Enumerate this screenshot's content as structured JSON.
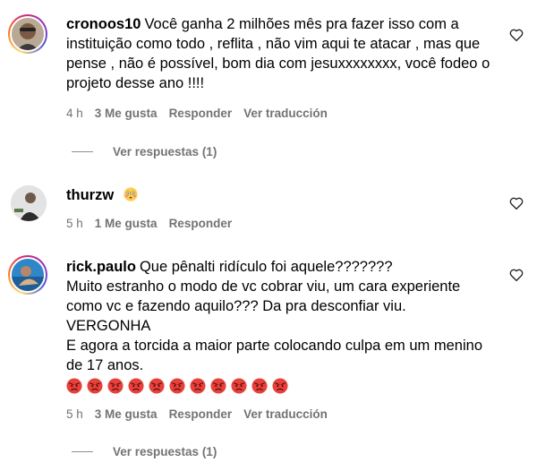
{
  "comments": [
    {
      "username": "cronoos10",
      "text": "Você ganha 2 milhões mês pra fazer isso com a instituição como todo , reflita , não vim aqui te atacar , mas que pense , não é possível, bom dia com jesuxxxxxxxx, você fodeo o projeto desse ano !!!!",
      "time": "4 h",
      "likes": "3 Me gusta",
      "reply_label": "Responder",
      "translate_label": "Ver traducción",
      "view_replies": "Ver respuestas (1)"
    },
    {
      "username": "thurzw",
      "text": "",
      "emoji": "flushed-face",
      "time": "5 h",
      "likes": "1 Me gusta",
      "reply_label": "Responder"
    },
    {
      "username": "rick.paulo",
      "line1": "Que pênalti ridículo foi aquele???????",
      "line2": "Muito estranho o modo de vc cobrar viu, um cara experiente como vc e fazendo aquilo??? Da pra desconfiar viu.",
      "line3": "VERGONHA",
      "line4": "E agora a torcida a maior parte colocando culpa em um menino de 17 anos.",
      "emoji": "angry-face",
      "emoji_count": 11,
      "time": "5 h",
      "likes": "3 Me gusta",
      "reply_label": "Responder",
      "translate_label": "Ver traducción",
      "view_replies": "Ver respuestas (1)"
    }
  ],
  "colors": {
    "meta": "#737373",
    "text": "#000000",
    "angry": "#e8403a"
  }
}
